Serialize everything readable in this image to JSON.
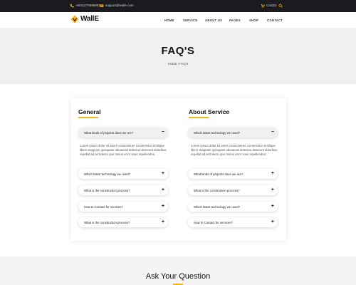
{
  "topbar": {
    "phone": "+0011278598881",
    "email": "support@walle.com",
    "cart": "Cart(0)"
  },
  "brand": {
    "name": "WallE"
  },
  "nav": [
    "HOME",
    "SERVICE",
    "ABOUT US",
    "PAGES",
    "SHOP",
    "CONTACT"
  ],
  "hero": {
    "title": "FAQ'S",
    "breadcrumb": "HOME / FAQ'S"
  },
  "faq": {
    "general": {
      "title": "General",
      "open_question": "What kinds of projects does we are?",
      "open_answer": "Lorem ipsum dolor sit amet consectetuer consectetur similique libero magnam quisquam obcaecati delectus deserunt doloribus repellat ad architecto quo minus error sous repellendus.",
      "items": [
        "Which latest technology we used?",
        "What is the construction process?",
        "How to Contact for services?",
        "What is the construction process?"
      ]
    },
    "about": {
      "title": "About Service",
      "open_question": "Which latest technology we used?",
      "open_answer": "Lorem ipsum dolor sit amet consectetuer consectetur similique libero magnam quisquam obcaecati delectus deserunt doloribus repellat ad architecto quo minus error sous repellendus.",
      "items": [
        "What kinds of projects does we are?",
        "What is the construction process?",
        "Which latest technology we used?",
        "How to Contact for services?"
      ]
    }
  },
  "ask": {
    "title": "Ask Your Question"
  },
  "colors": {
    "accent": "#f2b51b",
    "topbar": "#1b1b1f"
  }
}
